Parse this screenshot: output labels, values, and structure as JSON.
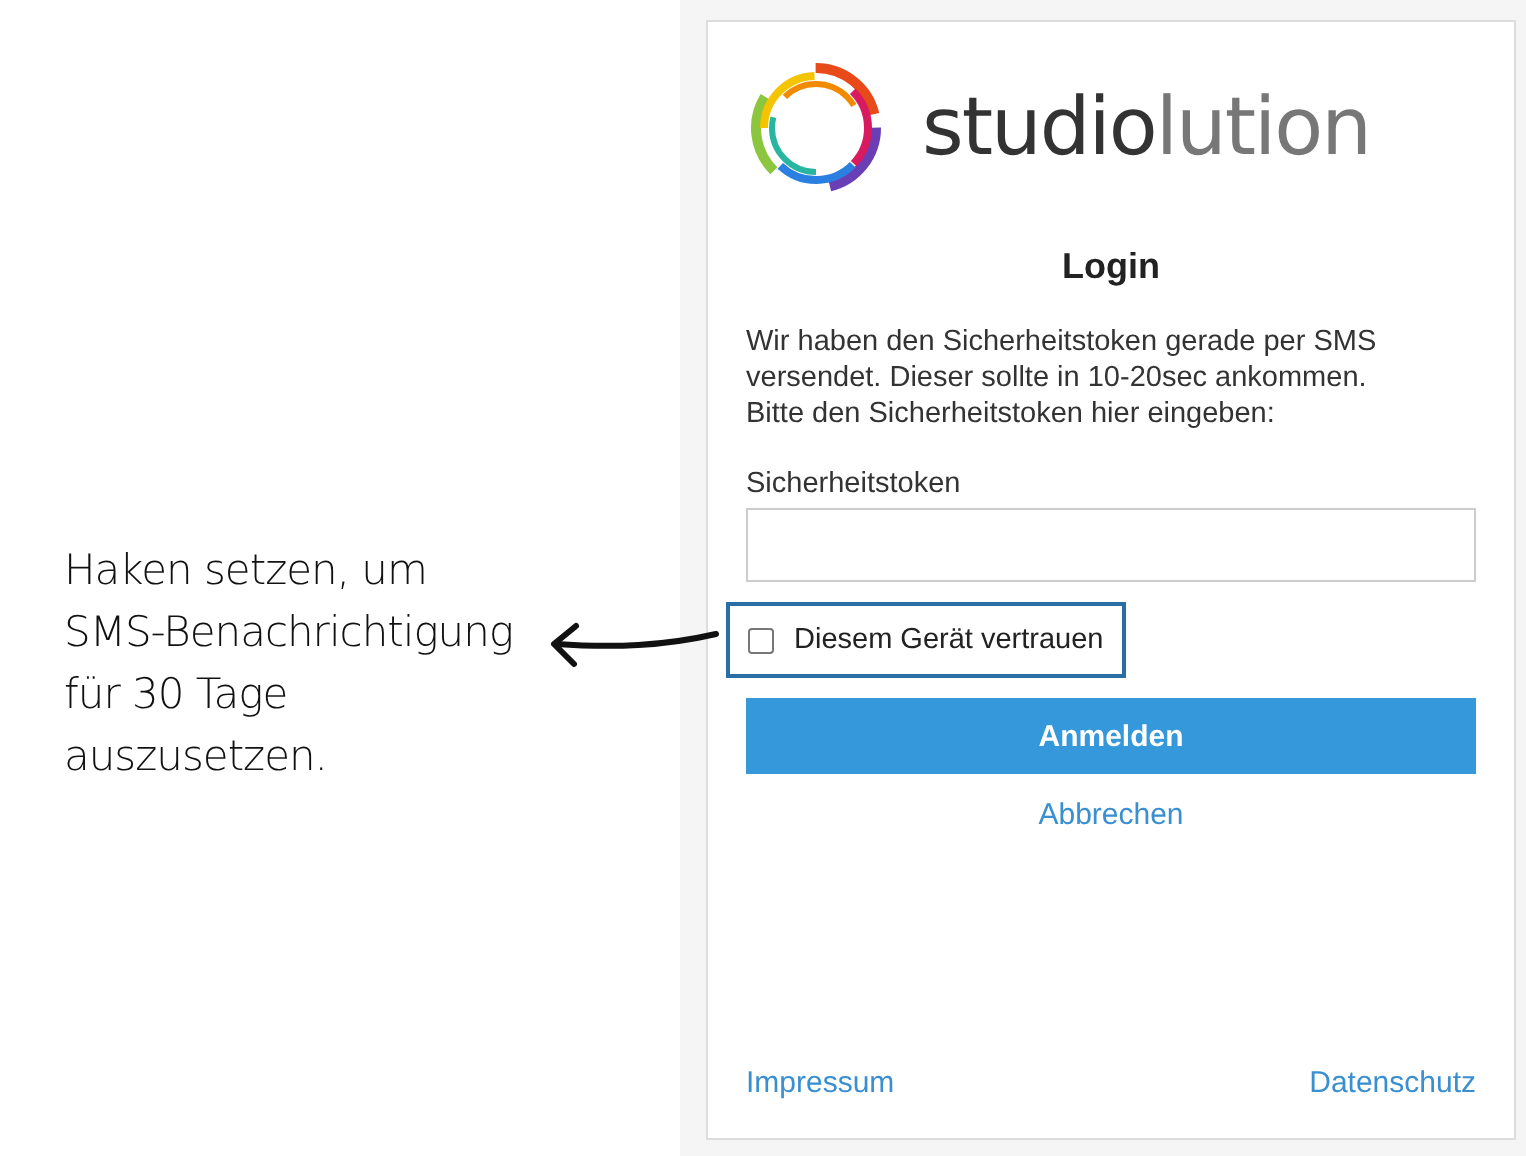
{
  "annotation": {
    "lines": [
      "Haken setzen, um",
      "SMS-Benachrichtigung",
      "für 30 Tage",
      "auszusetzen."
    ]
  },
  "logo": {
    "dark": "studio",
    "light": "lution"
  },
  "title": "Login",
  "message": [
    "Wir haben den Sicherheitstoken gerade per SMS",
    "versendet. Dieser sollte in 10-20sec ankommen.",
    "Bitte den Sicherheitstoken hier eingeben:"
  ],
  "token_field": {
    "label": "Sicherheitstoken"
  },
  "trust_checkbox": {
    "label": "Diesem Gerät vertrauen",
    "checked": false,
    "highlighted": true
  },
  "submit_button": "Anmelden",
  "cancel_link": "Abbrechen",
  "footer": {
    "left": "Impressum",
    "right": "Datenschutz"
  }
}
